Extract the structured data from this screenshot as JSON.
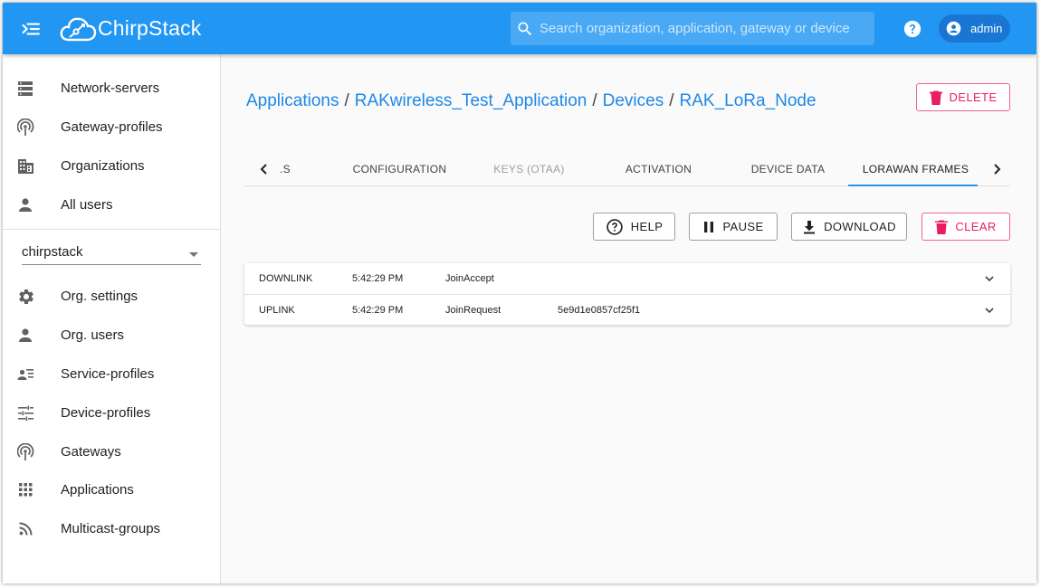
{
  "app": {
    "brand": "ChirpStack",
    "search_placeholder": "Search organization, application, gateway or device",
    "user": "admin"
  },
  "sidebar": {
    "admin_items": [
      {
        "label": "Network-servers",
        "icon": "server-icon"
      },
      {
        "label": "Gateway-profiles",
        "icon": "antenna-icon"
      },
      {
        "label": "Organizations",
        "icon": "building-icon"
      },
      {
        "label": "All users",
        "icon": "person-icon"
      }
    ],
    "org_select": "chirpstack",
    "org_items": [
      {
        "label": "Org. settings",
        "icon": "gear-icon"
      },
      {
        "label": "Org. users",
        "icon": "person-icon"
      },
      {
        "label": "Service-profiles",
        "icon": "account-details-icon"
      },
      {
        "label": "Device-profiles",
        "icon": "tune-icon"
      },
      {
        "label": "Gateways",
        "icon": "antenna-icon"
      },
      {
        "label": "Applications",
        "icon": "apps-grid-icon"
      },
      {
        "label": "Multicast-groups",
        "icon": "rss-icon"
      }
    ]
  },
  "breadcrumb": {
    "items": [
      "Applications",
      "RAKwireless_Test_Application",
      "Devices"
    ],
    "current": "RAK_LoRa_Node",
    "separator": "/"
  },
  "actions": {
    "delete": "DELETE",
    "help": "HELP",
    "pause": "PAUSE",
    "download": "DOWNLOAD",
    "clear": "CLEAR"
  },
  "tabs": [
    {
      "label": ".S",
      "state": "normal"
    },
    {
      "label": "CONFIGURATION",
      "state": "normal"
    },
    {
      "label": "KEYS (OTAA)",
      "state": "disabled"
    },
    {
      "label": "ACTIVATION",
      "state": "normal"
    },
    {
      "label": "DEVICE DATA",
      "state": "normal"
    },
    {
      "label": "LORAWAN FRAMES",
      "state": "active"
    }
  ],
  "frames": [
    {
      "direction": "DOWNLINK",
      "time": "5:42:29 PM",
      "type": "JoinAccept",
      "dev_eui": ""
    },
    {
      "direction": "UPLINK",
      "time": "5:42:29 PM",
      "type": "JoinRequest",
      "dev_eui": "5e9d1e0857cf25f1"
    }
  ],
  "colors": {
    "primary": "#2196f3",
    "link": "#1e88e5",
    "danger": "#e91e63"
  }
}
